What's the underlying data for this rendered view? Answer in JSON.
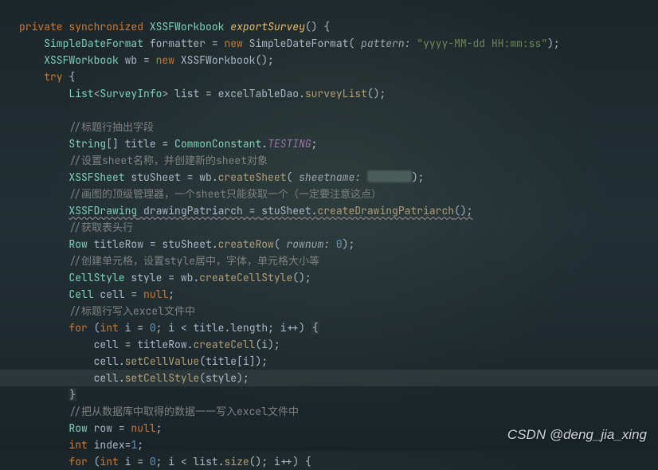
{
  "line1": {
    "kw1": "private",
    "kw2": "synchronized",
    "type": "XSSFWorkbook",
    "method": "exportSurvey",
    "parens": "()",
    "brace": " {"
  },
  "line2": {
    "type": "SimpleDateFormat",
    "var": "formatter",
    "eq": " = ",
    "kw": "new",
    "ctor": " SimpleDateFormat(",
    "paramName": " pattern: ",
    "str": "\"yyyy-MM-dd HH:mm:ss\"",
    "end": ");"
  },
  "line3": {
    "type": "XSSFWorkbook",
    "var": "wb",
    "eq": " = ",
    "kw": "new",
    "ctor": " XSSFWorkbook();"
  },
  "line4": {
    "kw": "try",
    "brace": " {"
  },
  "line5": {
    "type": "List",
    "lt": "<",
    "gtype": "SurveyInfo",
    "gt": "> ",
    "var": "list",
    "eq": " = ",
    "obj": "excelTableDao",
    "dot": ".",
    "m": "surveyList",
    "end": "();"
  },
  "c1": "//标题行抽出字段",
  "line7": {
    "type": "String",
    "arr": "[] ",
    "var": "title",
    "eq": " = ",
    "cls": "CommonConstant",
    "dot": ".",
    "field": "TESTING",
    "semi": ";"
  },
  "c2": "//设置sheet名称，并创建新的sheet对象",
  "line9": {
    "type": "XSSFSheet",
    "var": " stuSheet",
    "eq": " = ",
    "obj": "wb",
    "dot": ".",
    "m": "createSheet",
    "open": "(",
    "paramName": " sheetname: ",
    "end": ");"
  },
  "c3": "//画图的顶级管理器，一个sheet只能获取一个（一定要注意这点）",
  "line11": {
    "type": "XSSFDrawing",
    "var": " drawingPatriarch",
    "eq": " = ",
    "obj": "stuSheet",
    "dot": ".",
    "m": "createDrawingPatriarch",
    "end": "();"
  },
  "c4": "//获取表头行",
  "line13": {
    "type": "Row",
    "var": " titleRow",
    "eq": " = ",
    "obj": "stuSheet",
    "dot": ".",
    "m": "createRow",
    "open": "(",
    "paramName": " rownum: ",
    "num": "0",
    "end": ");"
  },
  "c5": "//创建单元格，设置style居中，字体，单元格大小等",
  "line15": {
    "type": "CellStyle",
    "var": " style",
    "eq": " = ",
    "obj": "wb",
    "dot": ".",
    "m": "createCellStyle",
    "end": "();"
  },
  "line16": {
    "type": "Cell",
    "var": " cell",
    "eq": " = ",
    "kw": "null",
    "semi": ";"
  },
  "c6": "//标题行写入excel文件中",
  "line18": {
    "kw": "for",
    "open": " (",
    "ikw": "int",
    "i": " i",
    "eq": " = ",
    "zero": "0",
    "semi1": "; ",
    "i2": "i",
    "lt": " < ",
    "arr": "title",
    "dot": ".",
    "len": "length",
    "semi2": "; ",
    "i3": "i",
    "inc": "++) ",
    "brace": "{"
  },
  "line19": {
    "var": "cell",
    "eq": " = ",
    "obj": "titleRow",
    "dot": ".",
    "m": "createCell",
    "open": "(",
    "i": "i",
    "end": ");"
  },
  "line20": {
    "var": "cell",
    "dot": ".",
    "m": "setCellValue",
    "open": "(",
    "arr": "title",
    "lb": "[",
    "i": "i",
    "rb": "]",
    "end": ");"
  },
  "line21": {
    "var": "cell",
    "dot": ".",
    "m": "setCellStyle",
    "open": "(",
    "arg": "style",
    "end": ");"
  },
  "line22": {
    "brace": "}"
  },
  "c7": "//把从数据库中取得的数据一一写入excel文件中",
  "line24": {
    "type": "Row",
    "var": " row",
    "eq": " = ",
    "kw": "null",
    "semi": ";"
  },
  "line25": {
    "kw": "int",
    "var": " index",
    "eq": "=",
    "num": "1",
    "semi": ";"
  },
  "line26": {
    "kw": "for",
    "open": " (",
    "ikw": "int",
    "i": " i",
    "eq": " = ",
    "zero": "0",
    "semi1": "; ",
    "i2": "i",
    "lt": " < ",
    "arr": "list",
    "dot": ".",
    "m": "size",
    "par": "()",
    "semi2": "; ",
    "i3": "i",
    "inc": "++) {"
  },
  "watermark": "CSDN @deng_jia_xing"
}
